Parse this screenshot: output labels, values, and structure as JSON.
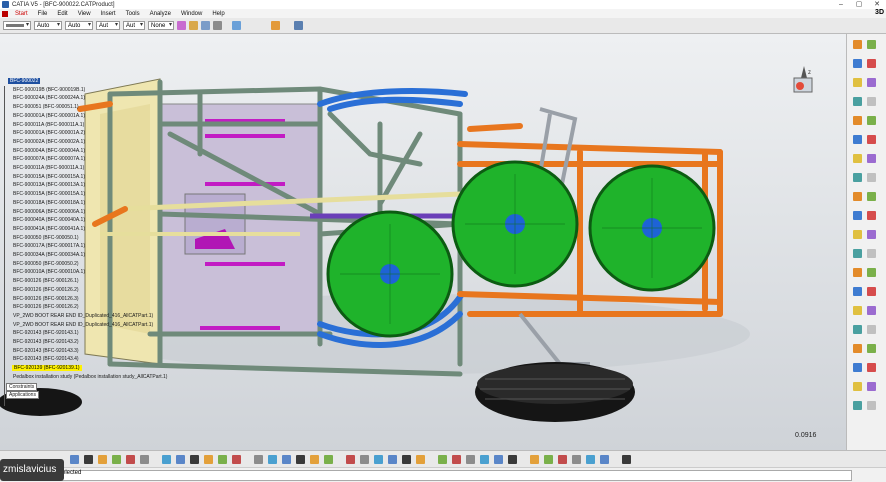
{
  "window": {
    "title": "CATIA V5 - [BFC-900022.CATProduct]",
    "controls": [
      "–",
      "▢",
      "✕"
    ]
  },
  "menu": {
    "items": [
      "Start",
      "File",
      "Edit",
      "View",
      "Insert",
      "Tools",
      "Analyze",
      "Window",
      "Help"
    ],
    "right_badge": "3D"
  },
  "toolbar": {
    "line_weight": "",
    "selects": [
      "Auto",
      "Auto",
      "Aut",
      "Aut",
      "None"
    ]
  },
  "tree": {
    "nodes": [
      {
        "label": "BFC-900022",
        "style": "hl"
      },
      {
        "label": "BFC-900019B (BFC-900019B.1)",
        "style": ""
      },
      {
        "label": "BFC-900024A (BFC-900024A.1)",
        "style": ""
      },
      {
        "label": "BFC-900051 (BFC-900051.1)",
        "style": ""
      },
      {
        "label": "BFC-900001A (BFC-900001A.1)",
        "style": ""
      },
      {
        "label": "BFC-900011A (BFC-900011A.1)",
        "style": ""
      },
      {
        "label": "BFC-900001A (BFC-900001A.2)",
        "style": ""
      },
      {
        "label": "BFC-900002A (BFC-900002A.1)",
        "style": ""
      },
      {
        "label": "BFC-900004A (BFC-900004A.1)",
        "style": ""
      },
      {
        "label": "BFC-900007A (BFC-900007A.1)",
        "style": ""
      },
      {
        "label": "BFC-900011A (BFC-900011A.1)",
        "style": ""
      },
      {
        "label": "BFC-900015A (BFC-900015A.1)",
        "style": ""
      },
      {
        "label": "BFC-900013A (BFC-900013A.1)",
        "style": ""
      },
      {
        "label": "BFC-900015A (BFC-900015A.1)",
        "style": ""
      },
      {
        "label": "BFC-900018A (BFC-900018A.1)",
        "style": ""
      },
      {
        "label": "BFC-900006A (BFC-900006A.1)",
        "style": ""
      },
      {
        "label": "BFC-900040A (BFC-900040A.1)",
        "style": ""
      },
      {
        "label": "BFC-900041A (BFC-900041A.1)",
        "style": ""
      },
      {
        "label": "BFC-900050 (BFC-900050.1)",
        "style": ""
      },
      {
        "label": "BFC-900017A (BFC-900017A.1)",
        "style": ""
      },
      {
        "label": "BFC-900034A (BFC-900034A.1)",
        "style": ""
      },
      {
        "label": "BFC-900050 (BFC-900050.2)",
        "style": ""
      },
      {
        "label": "BFC-900010A (BFC-900010A.1)",
        "style": ""
      },
      {
        "label": "BFC-900126 (BFC-900126.1)",
        "style": ""
      },
      {
        "label": "BFC-900126 (BFC-900126.2)",
        "style": ""
      },
      {
        "label": "BFC-900126 (BFC-900126.3)",
        "style": ""
      },
      {
        "label": "BFC-900126 (BFC-900126.2)",
        "style": ""
      },
      {
        "label": "VP_2WD BOOT REAR END ID_Duplicated_416_AllCATPart.1)",
        "style": ""
      },
      {
        "label": "VP_2WD BOOT REAR END ID_Duplicated_416_AllCATPart.1)",
        "style": ""
      },
      {
        "label": "BFC-920143 (BFC-920143.1)",
        "style": ""
      },
      {
        "label": "BFC-920143 (BFC-920143.2)",
        "style": ""
      },
      {
        "label": "BFC-920143 (BFC-920143.3)",
        "style": ""
      },
      {
        "label": "BFC-920143 (BFC-920143.4)",
        "style": ""
      },
      {
        "label": "BFC-920139 (BFC-920139.1)",
        "style": "yl"
      },
      {
        "label": "Pedalbox installation study (Pedalbox installation study_AllCATPart.1)",
        "style": ""
      },
      {
        "label": "Constraints",
        "style": "box"
      },
      {
        "label": "Applications",
        "style": "box"
      }
    ]
  },
  "viewport": {
    "zoom_readout": "0.0916",
    "colors": {
      "frame_green": "#6f8a7a",
      "frame_orange": "#e8761e",
      "frame_blue": "#2a6fd6",
      "tank_green": "#1fb32b",
      "panel_lavender": "#c9bfd8",
      "tire_black": "#151515"
    }
  },
  "right_toolbar": {
    "icons": [
      "sketch-icon",
      "pad-icon",
      "pocket-icon",
      "shaft-icon",
      "groove-icon",
      "hole-icon",
      "rib-icon",
      "slot-icon",
      "stiffener-icon",
      "multi-section-icon",
      "remove-icon",
      "fillet-icon",
      "chamfer-icon",
      "draft-icon",
      "shell-icon",
      "thickness-icon",
      "thread-icon",
      "translate-icon",
      "rotate-icon",
      "symmetry-icon",
      "mirror-icon",
      "pattern-icon",
      "scale-icon",
      "split-icon",
      "thick-surface-icon",
      "close-surface-icon",
      "sew-icon",
      "boolean-icon",
      "assemble-icon",
      "add-icon",
      "remove-lump-icon",
      "intersect-icon",
      "union-trim-icon",
      "constraint-icon",
      "measure-icon",
      "apply-material-icon",
      "wireframe-icon",
      "product-icon",
      "component-icon",
      "catalog-icon"
    ]
  },
  "bottom_toolbar": {
    "icons": [
      "new-icon",
      "open-icon",
      "save-icon",
      "print-icon",
      "cut-icon",
      "copy-icon",
      "paste-icon",
      "undo-icon",
      "redo-icon",
      "help-icon",
      "formula-icon",
      "catalog-icon",
      "table-icon",
      "measure-icon",
      "fly-icon",
      "fit-all-icon",
      "pan-icon",
      "rotate-icon",
      "zoom-in-icon",
      "zoom-out-icon",
      "normal-view-icon",
      "iso-view-icon",
      "shading-icon",
      "hide-show-icon",
      "swap-space-icon",
      "grid-icon",
      "snap-icon",
      "clash-icon",
      "section-icon",
      "distance-icon",
      "annotation-icon",
      "camera-icon",
      "light-icon",
      "material-icon",
      "scene-icon",
      "render-icon",
      "publish-icon"
    ]
  },
  "status": {
    "user": "zmislavicius",
    "message": "elected"
  }
}
